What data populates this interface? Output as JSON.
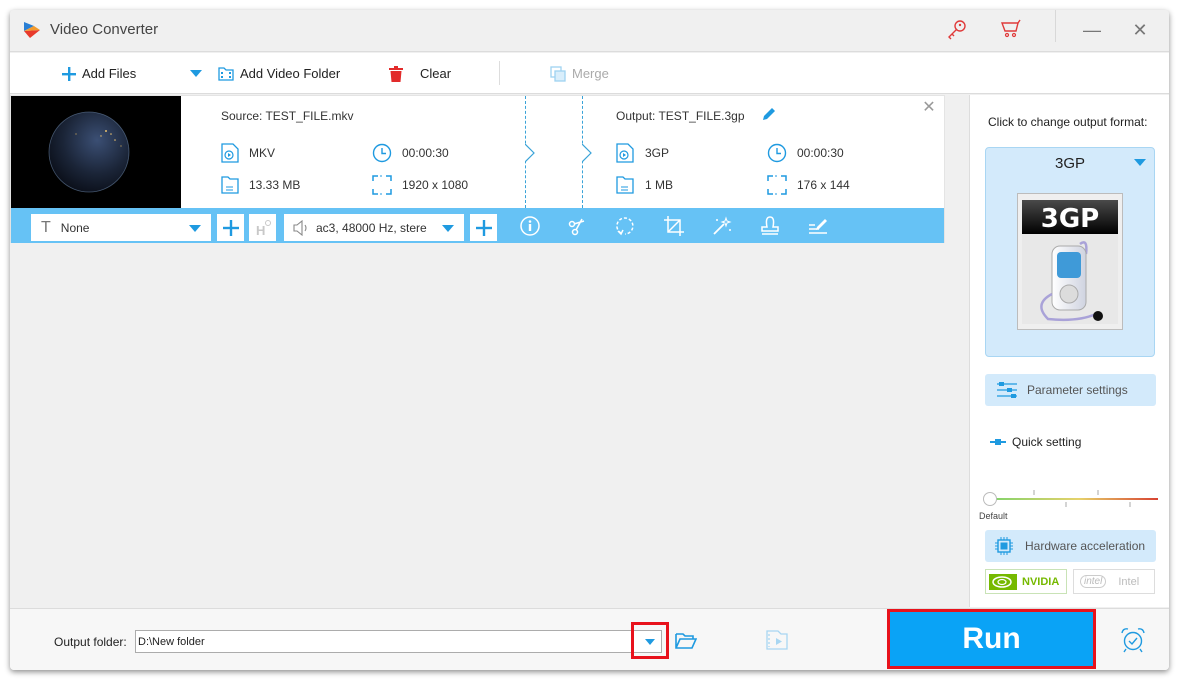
{
  "window": {
    "title": "Video Converter",
    "icons": [
      "key-icon",
      "cart-icon"
    ],
    "controls": [
      "minimize",
      "close"
    ]
  },
  "toolbar": {
    "add_files": "Add Files",
    "add_video_folder": "Add Video Folder",
    "clear": "Clear",
    "merge": "Merge"
  },
  "file_item": {
    "source": {
      "label": "Source: TEST_FILE.mkv",
      "format": "MKV",
      "duration": "00:00:30",
      "size": "13.33 MB",
      "resolution": "1920 x 1080"
    },
    "output": {
      "label": "Output: TEST_FILE.3gp",
      "format": "3GP",
      "duration": "00:00:30",
      "size": "1 MB",
      "resolution": "176 x 144"
    },
    "subtitle": "None",
    "audio": "ac3, 48000 Hz, stere",
    "tools": [
      "info",
      "cut",
      "rotate",
      "crop",
      "effects",
      "watermark",
      "edit"
    ]
  },
  "right_panel": {
    "change_format_label": "Click to change output format:",
    "format": "3GP",
    "format_image_text": "3GP",
    "parameter_settings": "Parameter settings",
    "quick_setting": "Quick setting",
    "slider_label": "Default",
    "slider_value_fraction": 0,
    "hardware_acceleration": "Hardware acceleration",
    "nvidia": "NVIDIA",
    "intel": "Intel",
    "intel_logo": "intel"
  },
  "bottom": {
    "output_folder_label": "Output folder:",
    "output_folder_value": "D:\\New folder",
    "run": "Run"
  },
  "colors": {
    "accent": "#1f9ae0",
    "bar": "#66c2f5",
    "run": "#0aa3f6",
    "highlight": "#e8121c",
    "icon_red": "#e03a3a"
  }
}
